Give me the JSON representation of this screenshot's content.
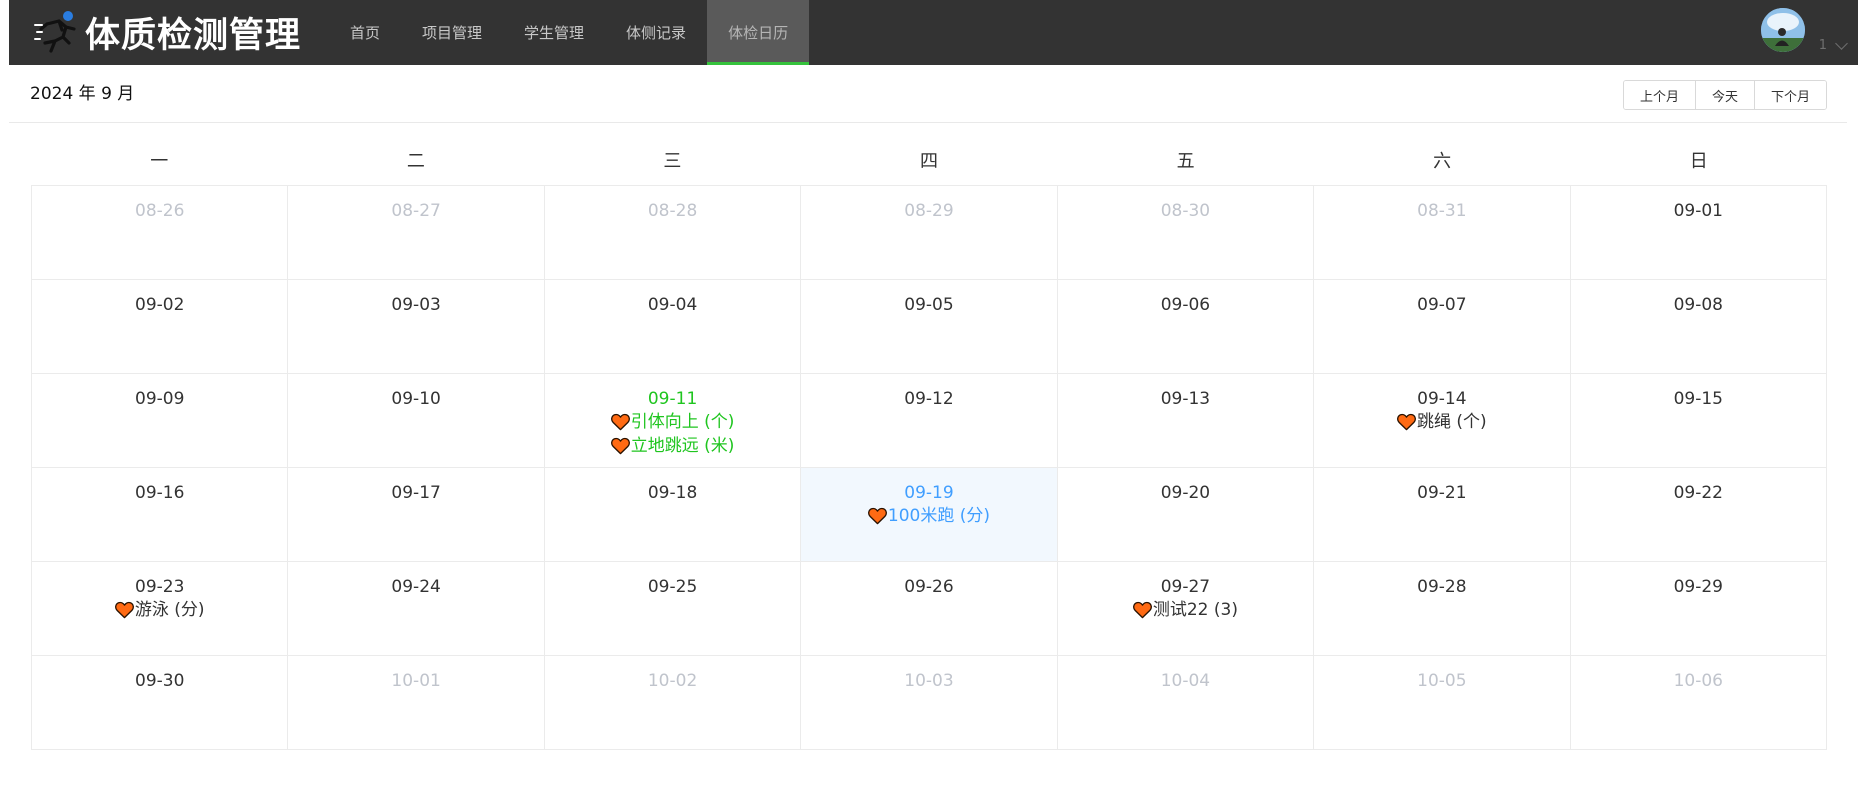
{
  "header": {
    "app_title": "体质检测管理",
    "nav": [
      {
        "label": "首页",
        "active": false
      },
      {
        "label": "项目管理",
        "active": false
      },
      {
        "label": "学生管理",
        "active": false
      },
      {
        "label": "体侧记录",
        "active": false
      },
      {
        "label": "体检日历",
        "active": true
      }
    ],
    "user": {
      "name": "1"
    }
  },
  "toolbar": {
    "month_title": "2024 年 9 月",
    "prev_label": "上个月",
    "today_label": "今天",
    "next_label": "下个月"
  },
  "calendar": {
    "weekdays": [
      "一",
      "二",
      "三",
      "四",
      "五",
      "六",
      "日"
    ],
    "days": [
      {
        "date": "08-26",
        "other": true,
        "events": []
      },
      {
        "date": "08-27",
        "other": true,
        "events": []
      },
      {
        "date": "08-28",
        "other": true,
        "events": []
      },
      {
        "date": "08-29",
        "other": true,
        "events": []
      },
      {
        "date": "08-30",
        "other": true,
        "events": []
      },
      {
        "date": "08-31",
        "other": true,
        "events": []
      },
      {
        "date": "09-01",
        "events": []
      },
      {
        "date": "09-02",
        "events": []
      },
      {
        "date": "09-03",
        "events": []
      },
      {
        "date": "09-04",
        "events": []
      },
      {
        "date": "09-05",
        "events": []
      },
      {
        "date": "09-06",
        "events": []
      },
      {
        "date": "09-07",
        "events": []
      },
      {
        "date": "09-08",
        "events": []
      },
      {
        "date": "09-09",
        "events": []
      },
      {
        "date": "09-10",
        "events": []
      },
      {
        "date": "09-11",
        "highlight": "green",
        "events": [
          "引体向上 (个)",
          "立地跳远 (米)"
        ]
      },
      {
        "date": "09-12",
        "events": []
      },
      {
        "date": "09-13",
        "events": []
      },
      {
        "date": "09-14",
        "events": [
          "跳绳 (个)"
        ]
      },
      {
        "date": "09-15",
        "events": []
      },
      {
        "date": "09-16",
        "events": []
      },
      {
        "date": "09-17",
        "events": []
      },
      {
        "date": "09-18",
        "events": []
      },
      {
        "date": "09-19",
        "today": true,
        "events": [
          "100米跑 (分)"
        ]
      },
      {
        "date": "09-20",
        "events": []
      },
      {
        "date": "09-21",
        "events": []
      },
      {
        "date": "09-22",
        "events": []
      },
      {
        "date": "09-23",
        "events": [
          "游泳 (分)"
        ]
      },
      {
        "date": "09-24",
        "events": []
      },
      {
        "date": "09-25",
        "events": []
      },
      {
        "date": "09-26",
        "events": []
      },
      {
        "date": "09-27",
        "events": [
          "测试22 (3)"
        ]
      },
      {
        "date": "09-28",
        "events": []
      },
      {
        "date": "09-29",
        "events": []
      },
      {
        "date": "09-30",
        "events": []
      },
      {
        "date": "10-01",
        "other": true,
        "events": []
      },
      {
        "date": "10-02",
        "other": true,
        "events": []
      },
      {
        "date": "10-03",
        "other": true,
        "events": []
      },
      {
        "date": "10-04",
        "other": true,
        "events": []
      },
      {
        "date": "10-05",
        "other": true,
        "events": []
      },
      {
        "date": "10-06",
        "other": true,
        "events": []
      }
    ]
  },
  "icons": {
    "logo": "runner-icon",
    "event": "heart-icon",
    "user_menu": "chevron-down-icon"
  },
  "colors": {
    "header_bg": "#333333",
    "nav_active_bg": "#5a5a5a",
    "nav_active_underline": "#35c23c",
    "today_bg": "#f2f8fe",
    "today_text": "#409eff",
    "event_green": "#1fc51f",
    "heart_fill": "#ff6a13"
  }
}
